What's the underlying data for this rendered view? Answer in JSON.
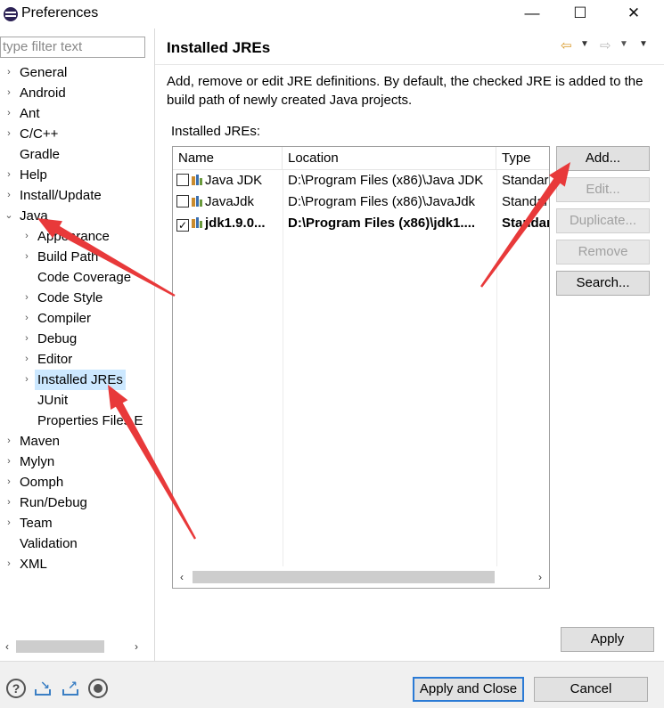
{
  "window": {
    "title": "Preferences",
    "minimize": "—",
    "maximize": "☐",
    "close": "✕"
  },
  "sidebar": {
    "filter_placeholder": "type filter text",
    "items": [
      {
        "label": "General",
        "expander": "›"
      },
      {
        "label": "Android",
        "expander": "›"
      },
      {
        "label": "Ant",
        "expander": "›"
      },
      {
        "label": "C/C++",
        "expander": "›"
      },
      {
        "label": "Gradle",
        "expander": ""
      },
      {
        "label": "Help",
        "expander": "›"
      },
      {
        "label": "Install/Update",
        "expander": "›"
      },
      {
        "label": "Java",
        "expander": "⌄"
      },
      {
        "label": "Appearance",
        "expander": "›"
      },
      {
        "label": "Build Path",
        "expander": "›"
      },
      {
        "label": "Code Coverage",
        "expander": ""
      },
      {
        "label": "Code Style",
        "expander": "›"
      },
      {
        "label": "Compiler",
        "expander": "›"
      },
      {
        "label": "Debug",
        "expander": "›"
      },
      {
        "label": "Editor",
        "expander": "›"
      },
      {
        "label": "Installed JREs",
        "expander": "›",
        "selected": true
      },
      {
        "label": "JUnit",
        "expander": ""
      },
      {
        "label": "Properties Files E",
        "expander": ""
      },
      {
        "label": "Maven",
        "expander": "›"
      },
      {
        "label": "Mylyn",
        "expander": "›"
      },
      {
        "label": "Oomph",
        "expander": "›"
      },
      {
        "label": "Run/Debug",
        "expander": "›"
      },
      {
        "label": "Team",
        "expander": "›"
      },
      {
        "label": "Validation",
        "expander": ""
      },
      {
        "label": "XML",
        "expander": "›"
      }
    ],
    "scroll_left": "‹",
    "scroll_right": "›"
  },
  "page": {
    "title": "Installed JREs",
    "nav_back": "⇦",
    "nav_forward": "⇨",
    "dropdown": "▼",
    "description": "Add, remove or edit JRE definitions. By default, the checked JRE is added to the build path of newly created Java projects.",
    "table_label": "Installed JREs:",
    "columns": [
      "Name",
      "Location",
      "Type"
    ],
    "rows": [
      {
        "name": "Java JDK",
        "location": "D:\\Program Files (x86)\\Java JDK",
        "type": "Standard",
        "checked": false,
        "bold": false
      },
      {
        "name": "JavaJdk",
        "location": "D:\\Program Files (x86)\\JavaJdk",
        "type": "Standard",
        "checked": false,
        "bold": false
      },
      {
        "name": "jdk1.9.0...",
        "location": "D:\\Program Files (x86)\\jdk1....",
        "type": "Standard",
        "checked": true,
        "bold": true
      }
    ],
    "check_mark": "✓",
    "buttons": {
      "add": "Add...",
      "edit": "Edit...",
      "duplicate": "Duplicate...",
      "remove": "Remove",
      "search": "Search..."
    },
    "scroll_left": "‹",
    "scroll_right": "›",
    "apply": "Apply"
  },
  "footer": {
    "help": "?",
    "apply_and_close": "Apply and Close",
    "cancel": "Cancel"
  },
  "annotation_color": "#e8393a"
}
